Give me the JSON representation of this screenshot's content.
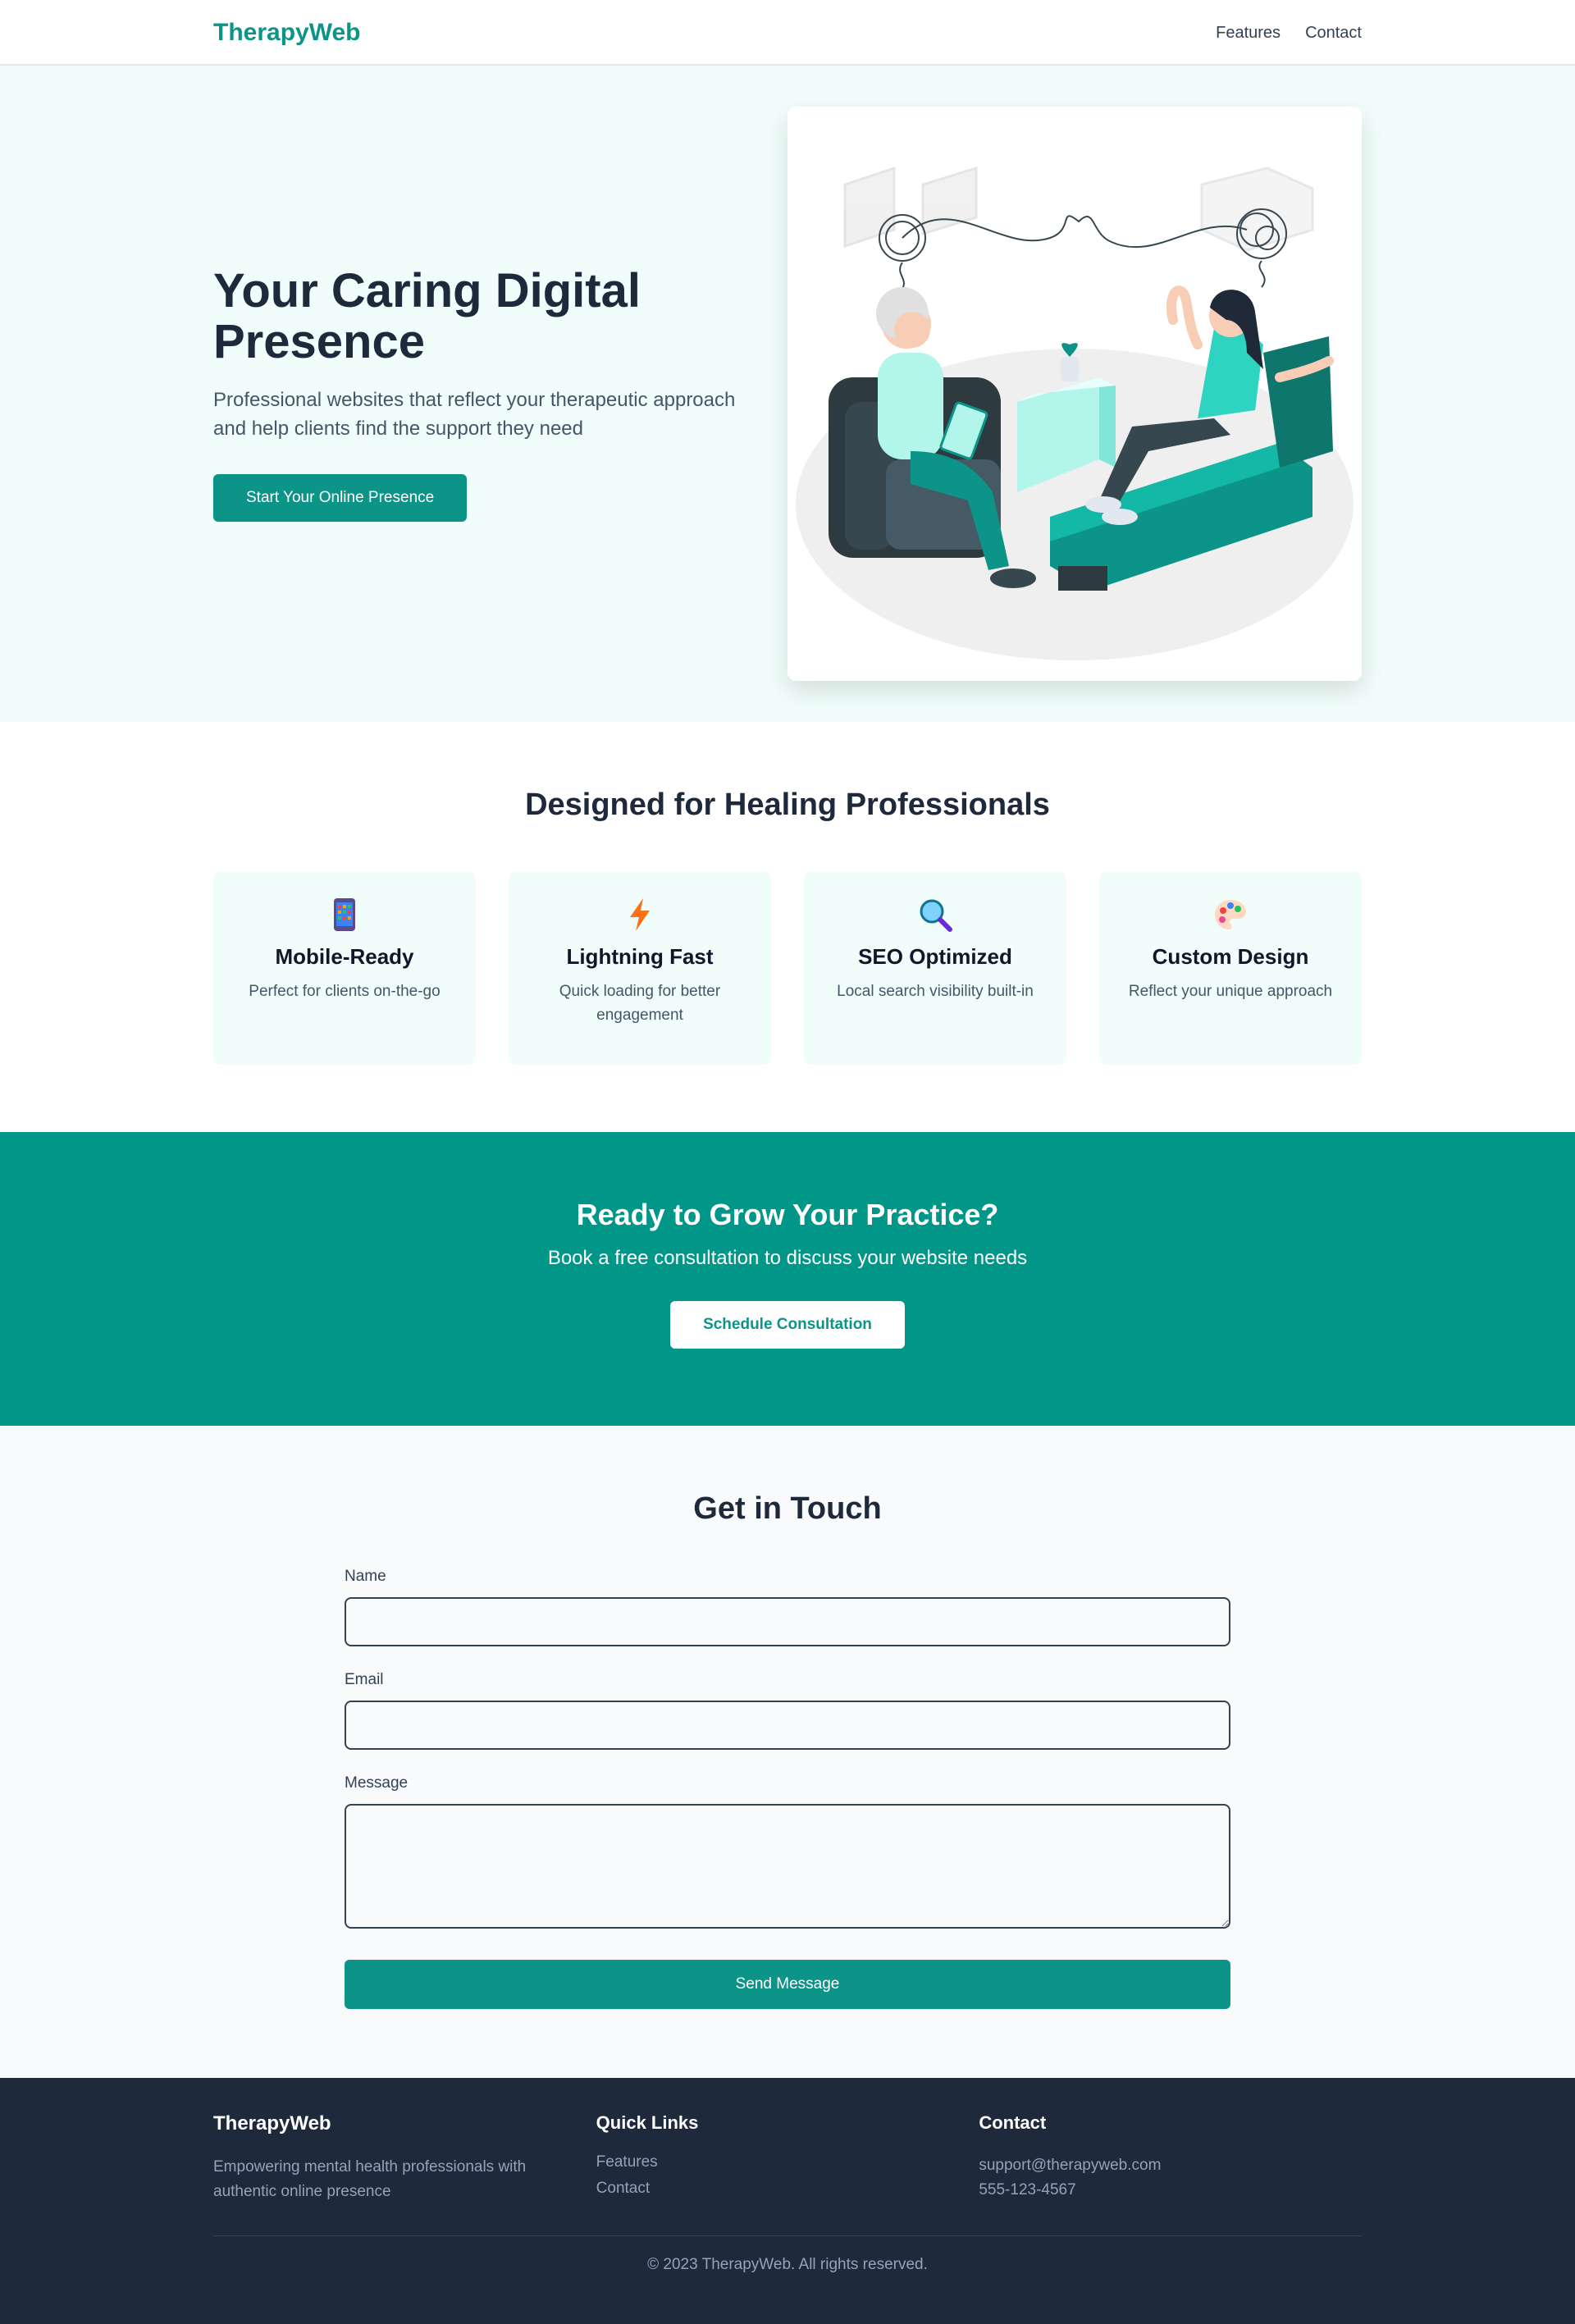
{
  "header": {
    "logo": "TherapyWeb",
    "nav": [
      {
        "label": "Features"
      },
      {
        "label": "Contact"
      }
    ]
  },
  "hero": {
    "title": "Your Caring Digital Presence",
    "subtitle": "Professional websites that reflect your therapeutic approach and help clients find the support they need",
    "cta_label": "Start Your Online Presence",
    "illustration": "therapy-session-illustration"
  },
  "features": {
    "title": "Designed for Healing Professionals",
    "items": [
      {
        "icon": "mobile-phone-icon",
        "title": "Mobile-Ready",
        "desc": "Perfect for clients on-the-go"
      },
      {
        "icon": "lightning-icon",
        "title": "Lightning Fast",
        "desc": "Quick loading for better engagement"
      },
      {
        "icon": "magnifier-icon",
        "title": "SEO Optimized",
        "desc": "Local search visibility built-in"
      },
      {
        "icon": "palette-icon",
        "title": "Custom Design",
        "desc": "Reflect your unique approach"
      }
    ]
  },
  "cta": {
    "title": "Ready to Grow Your Practice?",
    "subtitle": "Book a free consultation to discuss your website needs",
    "button_label": "Schedule Consultation"
  },
  "contact": {
    "title": "Get in Touch",
    "fields": {
      "name_label": "Name",
      "name_value": "",
      "email_label": "Email",
      "email_value": "",
      "message_label": "Message",
      "message_value": ""
    },
    "submit_label": "Send Message"
  },
  "footer": {
    "brand": "TherapyWeb",
    "tagline": "Empowering mental health professionals with authentic online presence",
    "quick_links_heading": "Quick Links",
    "quick_links": [
      {
        "label": "Features"
      },
      {
        "label": "Contact"
      }
    ],
    "contact_heading": "Contact",
    "email": "support@therapyweb.com",
    "phone": "555-123-4567",
    "copyright": "© 2023 TherapyWeb. All rights reserved."
  },
  "colors": {
    "brand": "#0d9488",
    "cta_bg": "#009688",
    "hero_bg": "#f0fdfa",
    "footer_bg": "#1e293b"
  }
}
